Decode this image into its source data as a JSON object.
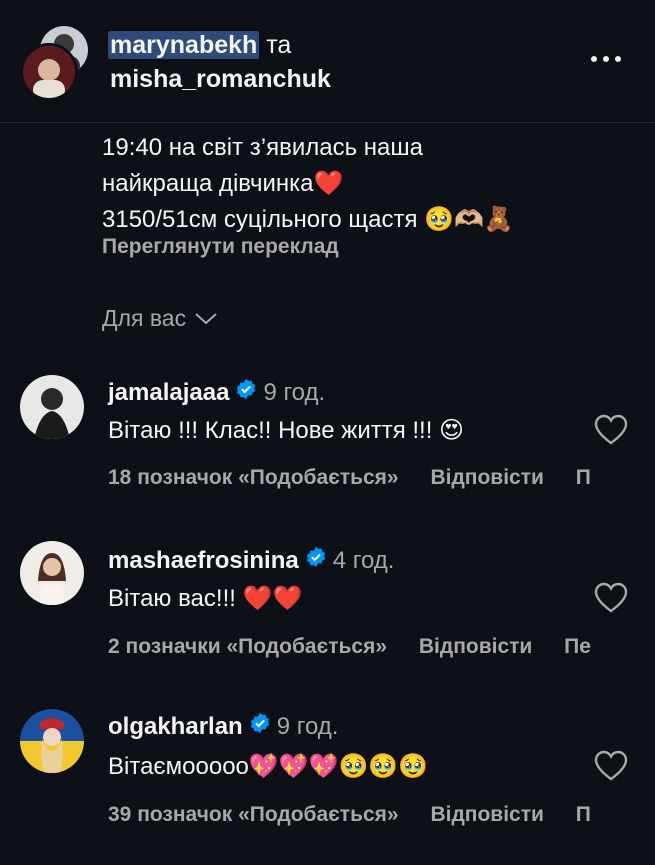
{
  "header": {
    "user1": "marynabekh",
    "joiner": "та",
    "user2": "misha_romanchuk",
    "more_icon": "more-horizontal-icon"
  },
  "post": {
    "line1": "19:40 на світ з’явилась наша",
    "line2": "найкраща дівчинка❤️",
    "line3": "3150/51см суцільного щастя 🥹🫶🏼🧸",
    "translate": "Переглянути переклад"
  },
  "filter": {
    "label": "Для вас",
    "icon": "chevron-down-icon"
  },
  "comments": [
    {
      "username": "jamalajaaa",
      "time": "9 год.",
      "text": "Вітаю !!! Клас!! Нове життя !!! 😍",
      "likes": "18 позначок «Подобається»",
      "reply": "Відповісти",
      "extra": "П"
    },
    {
      "username": "mashaefrosinina",
      "time": "4 год.",
      "text": "Вітаю вас!!! ❤️❤️",
      "likes": "2 позначки «Подобається»",
      "reply": "Відповісти",
      "extra": "Пе"
    },
    {
      "username": "olgakharlan",
      "time": "9 год.",
      "text": "Вітаємоoooo💖💖💖🥹🥹🥹",
      "likes": "39 позначок «Подобається»",
      "reply": "Відповісти",
      "extra": "П"
    }
  ],
  "colors": {
    "background": "#0d1016",
    "secondary_text": "#a8a8a8",
    "verified": "#0095f6",
    "selection": "#2e4b7a"
  }
}
